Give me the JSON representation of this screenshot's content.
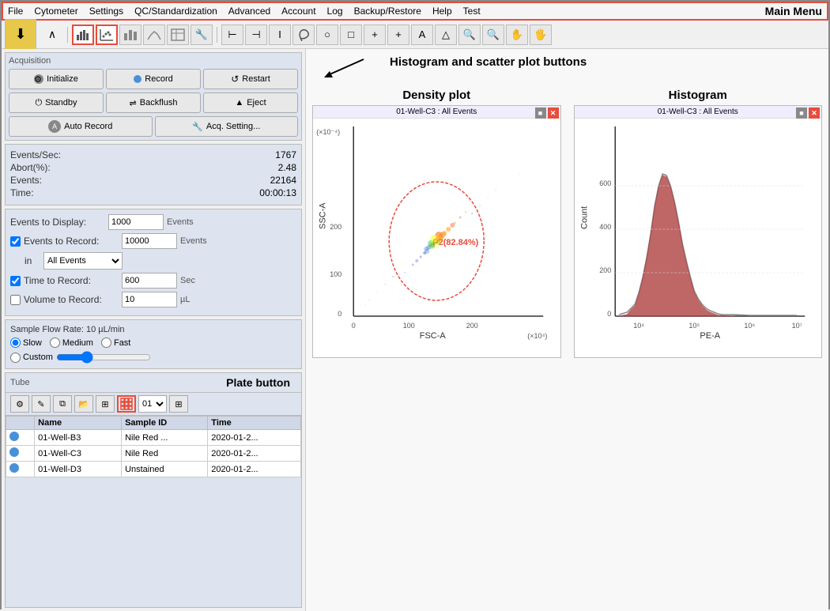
{
  "menubar": {
    "items": [
      "File",
      "Cytometer",
      "Settings",
      "QC/Standardization",
      "Advanced",
      "Account",
      "Log",
      "Backup/Restore",
      "Help",
      "Test"
    ],
    "main_menu_label": "Main Menu"
  },
  "acquisition": {
    "title": "Acquisition",
    "buttons": {
      "initialize": "Initialize",
      "record": "Record",
      "restart": "Restart",
      "standby": "Standby",
      "backflush": "Backflush",
      "eject": "Eject",
      "auto_record": "Auto Record",
      "acq_setting": "Acq. Setting..."
    },
    "stats": {
      "events_per_sec_label": "Events/Sec:",
      "events_per_sec_value": "1767",
      "abort_label": "Abort(%):",
      "abort_value": "2.48",
      "events_label": "Events:",
      "events_value": "22164",
      "time_label": "Time:",
      "time_value": "00:00:13"
    },
    "settings": {
      "events_to_display_label": "Events to Display:",
      "events_to_display_value": "1000",
      "events_to_display_unit": "Events",
      "events_to_record_label": "Events to Record:",
      "events_to_record_value": "10000",
      "events_to_record_unit": "Events",
      "in_label": "in",
      "in_value": "All Events",
      "time_to_record_label": "Time to Record:",
      "time_to_record_value": "600",
      "time_to_record_unit": "Sec",
      "volume_to_record_label": "Volume to Record:",
      "volume_to_record_value": "10",
      "volume_to_record_unit": "µL"
    },
    "flow_rate": {
      "title": "Sample Flow Rate:  10 µL/min",
      "options": [
        "Slow",
        "Medium",
        "Fast",
        "Custom"
      ]
    }
  },
  "tube": {
    "title": "Tube",
    "plate_button_label": "Plate button",
    "tube_number": "01",
    "table": {
      "headers": [
        "",
        "Name",
        "Sample ID",
        "Time"
      ],
      "rows": [
        {
          "name": "01-Well-B3",
          "sample_id": "Nile Red ...",
          "time": "2020-01-2..."
        },
        {
          "name": "01-Well-C3",
          "sample_id": "Nile Red",
          "time": "2020-01-2..."
        },
        {
          "name": "01-Well-D3",
          "sample_id": "Unstained",
          "time": "2020-01-2..."
        }
      ]
    }
  },
  "plots": {
    "scatter_plot_label": "Histogram and scatter plot buttons",
    "density_plot": {
      "title": "Density plot",
      "header": "01-Well-C3 : All Events",
      "gate_label": "P2(82.84%)",
      "x_axis": "FSC-A",
      "y_axis": "SSC-A",
      "x_unit": "(×10⁴)",
      "y_unit": "(×10⁻⁴)"
    },
    "histogram": {
      "title": "Histogram",
      "header": "01-Well-C3 : All Events",
      "x_axis": "PE-A",
      "y_axis": "Count",
      "x_labels": [
        "10⁴",
        "10⁵",
        "10⁶",
        "10⁷"
      ]
    }
  }
}
